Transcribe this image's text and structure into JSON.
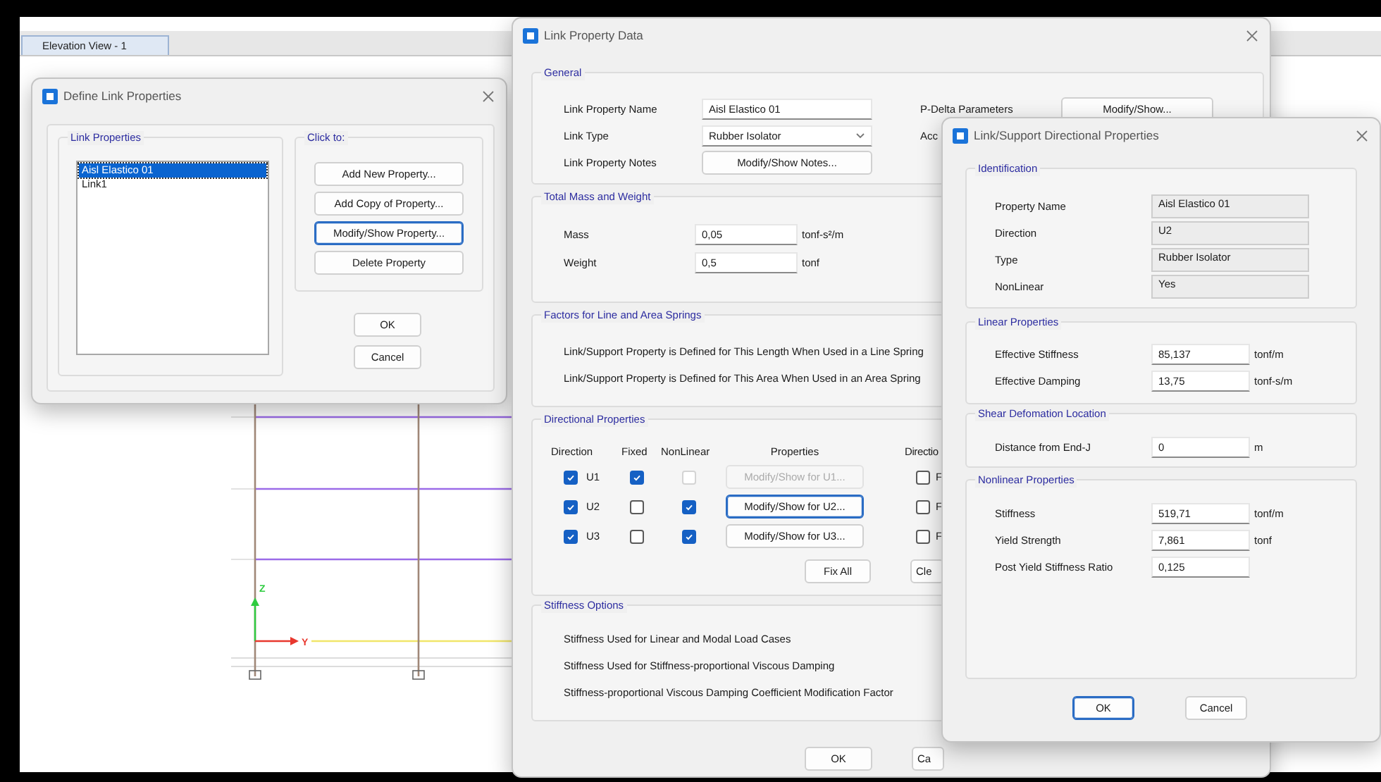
{
  "app": {
    "tab": {
      "label": "Elevation View - 1",
      "selected": true
    },
    "axis_labels": [
      "Z",
      "Y"
    ]
  },
  "define_dialog": {
    "title": "Define Link Properties",
    "list_heading": "Link Properties",
    "items": [
      {
        "label": "Aisl Elastico 01",
        "selected": true
      },
      {
        "label": "Link1",
        "selected": false
      }
    ],
    "actions_heading": "Click to:",
    "actions": [
      {
        "label": "Add New Property...",
        "focused": false
      },
      {
        "label": "Add Copy of Property...",
        "focused": false
      },
      {
        "label": "Modify/Show Property...",
        "focused": true
      },
      {
        "label": "Delete Property",
        "focused": false
      }
    ],
    "buttons": [
      "OK",
      "Cancel"
    ]
  },
  "data_dialog": {
    "title": "Link Property Data",
    "general": {
      "heading": "General",
      "name_label": "Link Property Name",
      "name_value": "Aisl Elastico 01",
      "type_label": "Link Type",
      "type_value": "Rubber Isolator",
      "notes_label": "Link Property Notes",
      "notes_button": "Modify/Show Notes...",
      "pdelta_label": "P-Delta Parameters",
      "pdelta_button": "Modify/Show...",
      "cut_label": "Acc"
    },
    "mass": {
      "heading": "Total Mass and Weight",
      "rows": [
        {
          "label": "Mass",
          "value": "0,05",
          "unit": "tonf-s²/m"
        },
        {
          "label": "Weight",
          "value": "0,5",
          "unit": "tonf"
        }
      ]
    },
    "factors": {
      "heading": "Factors for Line and Area Springs",
      "lines": [
        "Link/Support Property is Defined for This Length When Used in a Line Spring",
        "Link/Support Property is Defined for This Area When Used in an Area Spring"
      ]
    },
    "directional": {
      "heading": "Directional Properties",
      "columns": [
        "Direction",
        "Fixed",
        "NonLinear",
        "Properties",
        "Directio"
      ],
      "rows": [
        {
          "direction": "U1",
          "checked": true,
          "fixed": true,
          "nonlinear": false,
          "nonlinear_disabled": true,
          "button": "Modify/Show for U1...",
          "button_disabled": true,
          "button_focused": false,
          "side_checked": false,
          "side_label": "F"
        },
        {
          "direction": "U2",
          "checked": true,
          "fixed": false,
          "nonlinear": true,
          "nonlinear_disabled": false,
          "button": "Modify/Show for U2...",
          "button_disabled": false,
          "button_focused": true,
          "side_checked": false,
          "side_label": "F"
        },
        {
          "direction": "U3",
          "checked": true,
          "fixed": false,
          "nonlinear": true,
          "nonlinear_disabled": false,
          "button": "Modify/Show for U3...",
          "button_disabled": false,
          "button_focused": false,
          "side_checked": false,
          "side_label": "F"
        }
      ],
      "fix_all": "Fix All",
      "clear": "Cle"
    },
    "stiffness": {
      "heading": "Stiffness Options",
      "lines": [
        "Stiffness Used for Linear and Modal Load Cases",
        "Stiffness Used for Stiffness-proportional Viscous Damping",
        "Stiffness-proportional Viscous Damping Coefficient Modification Factor"
      ]
    },
    "buttons": [
      "OK",
      "Ca"
    ]
  },
  "support_dialog": {
    "title": "Link/Support Directional Properties",
    "identification": {
      "heading": "Identification",
      "rows": [
        {
          "label": "Property Name",
          "value": "Aisl Elastico 01"
        },
        {
          "label": "Direction",
          "value": "U2"
        },
        {
          "label": "Type",
          "value": "Rubber Isolator"
        },
        {
          "label": "NonLinear",
          "value": "Yes"
        }
      ]
    },
    "linear": {
      "heading": "Linear Properties",
      "rows": [
        {
          "label": "Effective Stiffness",
          "value": "85,137",
          "unit": "tonf/m"
        },
        {
          "label": "Effective Damping",
          "value": "13,75",
          "unit": "tonf-s/m"
        }
      ]
    },
    "shear": {
      "heading": "Shear Defomation Location",
      "rows": [
        {
          "label": "Distance from End-J",
          "value": "0",
          "unit": "m"
        }
      ]
    },
    "nonlinear": {
      "heading": "Nonlinear Properties",
      "rows": [
        {
          "label": "Stiffness",
          "value": "519,71",
          "unit": "tonf/m"
        },
        {
          "label": "Yield Strength",
          "value": "7,861",
          "unit": "tonf"
        },
        {
          "label": "Post Yield Stiffness Ratio",
          "value": "0,125"
        }
      ]
    },
    "buttons": [
      {
        "label": "OK",
        "focused": true
      },
      {
        "label": "Cancel",
        "focused": false
      }
    ]
  }
}
